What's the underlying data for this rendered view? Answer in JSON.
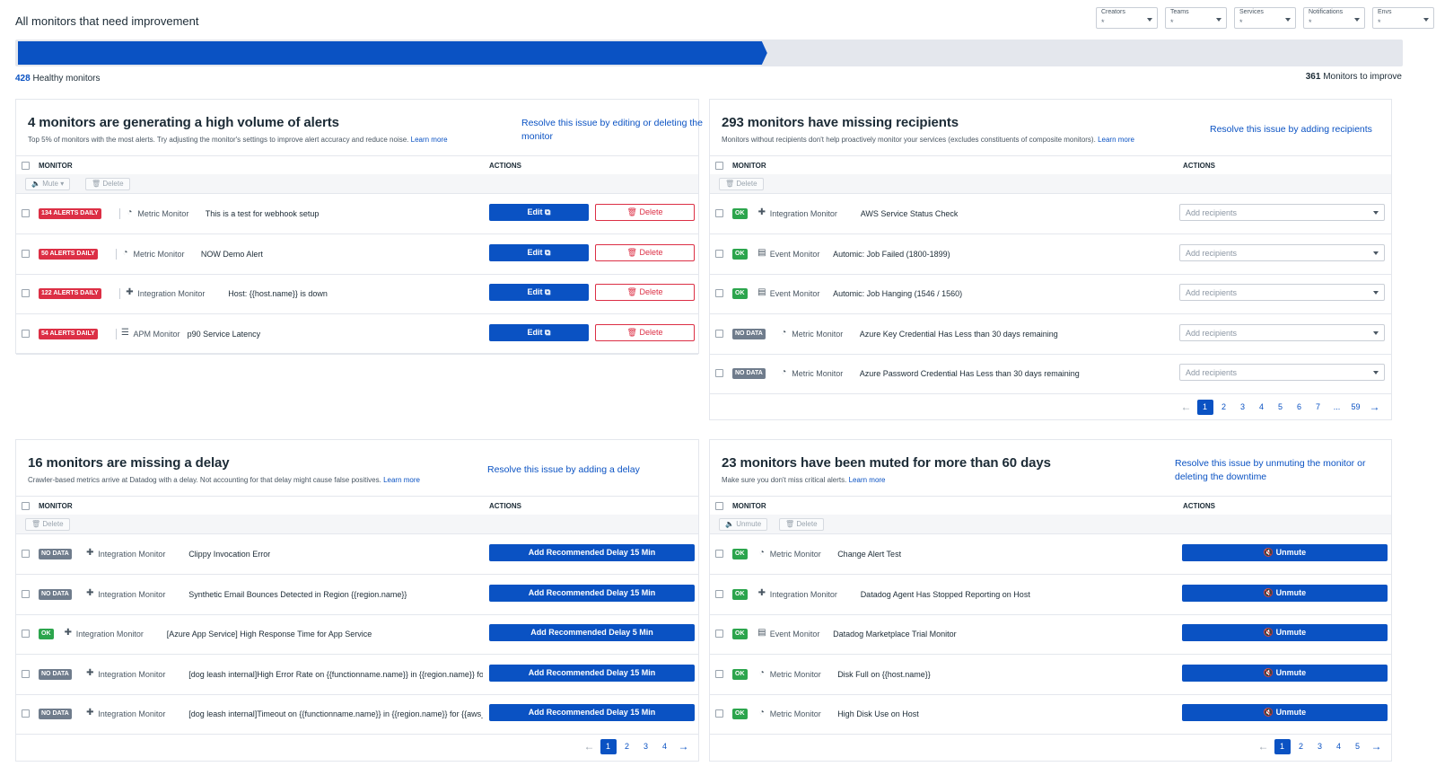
{
  "header": {
    "title": "All monitors that need improvement",
    "filters": [
      {
        "label": "Creators",
        "value": "*"
      },
      {
        "label": "Teams",
        "value": "*"
      },
      {
        "label": "Services",
        "value": "*"
      },
      {
        "label": "Notifications",
        "value": "*"
      },
      {
        "label": "Envs",
        "value": "*"
      }
    ],
    "progress": {
      "healthy_fraction": 0.54,
      "color": "#0a52c3"
    },
    "healthy_count": "428",
    "healthy_label": "Healthy monitors",
    "improve_count": "361",
    "improve_label": "Monitors to improve"
  },
  "col_monitor": "MONITOR",
  "col_actions": "ACTIONS",
  "cards": {
    "alerts": {
      "title": "4 monitors are generating a high volume of alerts",
      "desc": "Top 5% of monitors with the most alerts. Try adjusting the monitor's settings to improve alert accuracy and reduce noise.",
      "learn_more": "Learn more",
      "resolve": "Resolve this issue by editing or deleting the monitor",
      "bulk": {
        "mute": "Mute",
        "delete": "Delete"
      },
      "edit_label": "Edit",
      "delete_label": "Delete",
      "rows": [
        {
          "badge": "134 ALERTS DAILY",
          "icon": "gauge-icon",
          "type": "Metric Monitor",
          "name": "This is a test for webhook setup"
        },
        {
          "badge": "50 ALERTS DAILY",
          "icon": "gauge-icon",
          "type": "Metric Monitor",
          "name": "NOW Demo Alert"
        },
        {
          "badge": "122 ALERTS DAILY",
          "icon": "puzzle-icon",
          "type": "Integration Monitor",
          "name": "Host: {{host.name}} is down"
        },
        {
          "badge": "54 ALERTS DAILY",
          "icon": "apm-icon",
          "type": "APM Monitor",
          "name": "p90 Service Latency"
        }
      ]
    },
    "recipients": {
      "title": "293 monitors have missing recipients",
      "desc": "Monitors without recipients don't help proactively monitor your services (excludes constituents of composite monitors).",
      "learn_more": "Learn more",
      "resolve": "Resolve this issue by adding recipients",
      "bulk": {
        "delete": "Delete"
      },
      "placeholder": "Add recipients",
      "rows": [
        {
          "badge": "OK",
          "status": "ok",
          "icon": "puzzle-icon",
          "type": "Integration Monitor",
          "name": "AWS Service Status Check"
        },
        {
          "badge": "OK",
          "status": "ok",
          "icon": "event-icon",
          "type": "Event Monitor",
          "name": "Automic: Job Failed (1800-1899)"
        },
        {
          "badge": "OK",
          "status": "ok",
          "icon": "event-icon",
          "type": "Event Monitor",
          "name": "Automic: Job Hanging (1546 / 1560)"
        },
        {
          "badge": "NO DATA",
          "status": "nodata",
          "icon": "gauge-icon",
          "type": "Metric Monitor",
          "name": "Azure Key Credential Has Less than 30 days remaining"
        },
        {
          "badge": "NO DATA",
          "status": "nodata",
          "icon": "gauge-icon",
          "type": "Metric Monitor",
          "name": "Azure Password Credential Has Less than 30 days remaining"
        }
      ],
      "pages": [
        "1",
        "2",
        "3",
        "4",
        "5",
        "6",
        "7",
        "...",
        "59"
      ]
    },
    "delay": {
      "title": "16 monitors are missing a delay",
      "desc": "Crawler-based metrics arrive at Datadog with a delay. Not accounting for that delay might cause false positives.",
      "learn_more": "Learn more",
      "resolve": "Resolve this issue by adding a delay",
      "bulk": {
        "delete": "Delete"
      },
      "rows": [
        {
          "badge": "NO DATA",
          "status": "nodata",
          "icon": "puzzle-icon",
          "type": "Integration Monitor",
          "name": "Clippy Invocation Error",
          "action": "Add Recommended Delay 15 Min"
        },
        {
          "badge": "NO DATA",
          "status": "nodata",
          "icon": "puzzle-icon",
          "type": "Integration Monitor",
          "name": "Synthetic Email Bounces Detected in Region {{region.name}}",
          "action": "Add Recommended Delay 15 Min"
        },
        {
          "badge": "OK",
          "status": "ok",
          "icon": "puzzle-icon",
          "type": "Integration Monitor",
          "name": "[Azure App Service] High Response Time for App Service",
          "action": "Add Recommended Delay 5 Min"
        },
        {
          "badge": "NO DATA",
          "status": "nodata",
          "icon": "puzzle-icon",
          "type": "Integration Monitor",
          "name": "[dog leash internal]High Error Rate on {{functionname.name}} in {{region.name}} for",
          "action": "Add Recommended Delay 15 Min"
        },
        {
          "badge": "NO DATA",
          "status": "nodata",
          "icon": "puzzle-icon",
          "type": "Integration Monitor",
          "name": "[dog leash internal]Timeout on {{functionname.name}} in {{region.name}} for {{aws_",
          "action": "Add Recommended Delay 15 Min"
        }
      ],
      "pages": [
        "1",
        "2",
        "3",
        "4"
      ]
    },
    "muted": {
      "title": "23 monitors have been muted for more than 60 days",
      "desc": "Make sure you don't miss critical alerts.",
      "learn_more": "Learn more",
      "resolve": "Resolve this issue by unmuting the monitor or deleting the downtime",
      "bulk": {
        "unmute": "Unmute",
        "delete": "Delete"
      },
      "unmute_label": "Unmute",
      "rows": [
        {
          "badge": "OK",
          "status": "ok",
          "icon": "gauge-icon",
          "type": "Metric Monitor",
          "name": "Change Alert Test"
        },
        {
          "badge": "OK",
          "status": "ok",
          "icon": "puzzle-icon",
          "type": "Integration Monitor",
          "name": "Datadog Agent Has Stopped Reporting on Host"
        },
        {
          "badge": "OK",
          "status": "ok",
          "icon": "event-icon",
          "type": "Event Monitor",
          "name": "Datadog Marketplace Trial Monitor"
        },
        {
          "badge": "OK",
          "status": "ok",
          "icon": "gauge-icon",
          "type": "Metric Monitor",
          "name": "Disk Full on {{host.name}}"
        },
        {
          "badge": "OK",
          "status": "ok",
          "icon": "gauge-icon",
          "type": "Metric Monitor",
          "name": "High Disk Use on Host"
        }
      ],
      "pages": [
        "1",
        "2",
        "3",
        "4",
        "5"
      ]
    }
  }
}
